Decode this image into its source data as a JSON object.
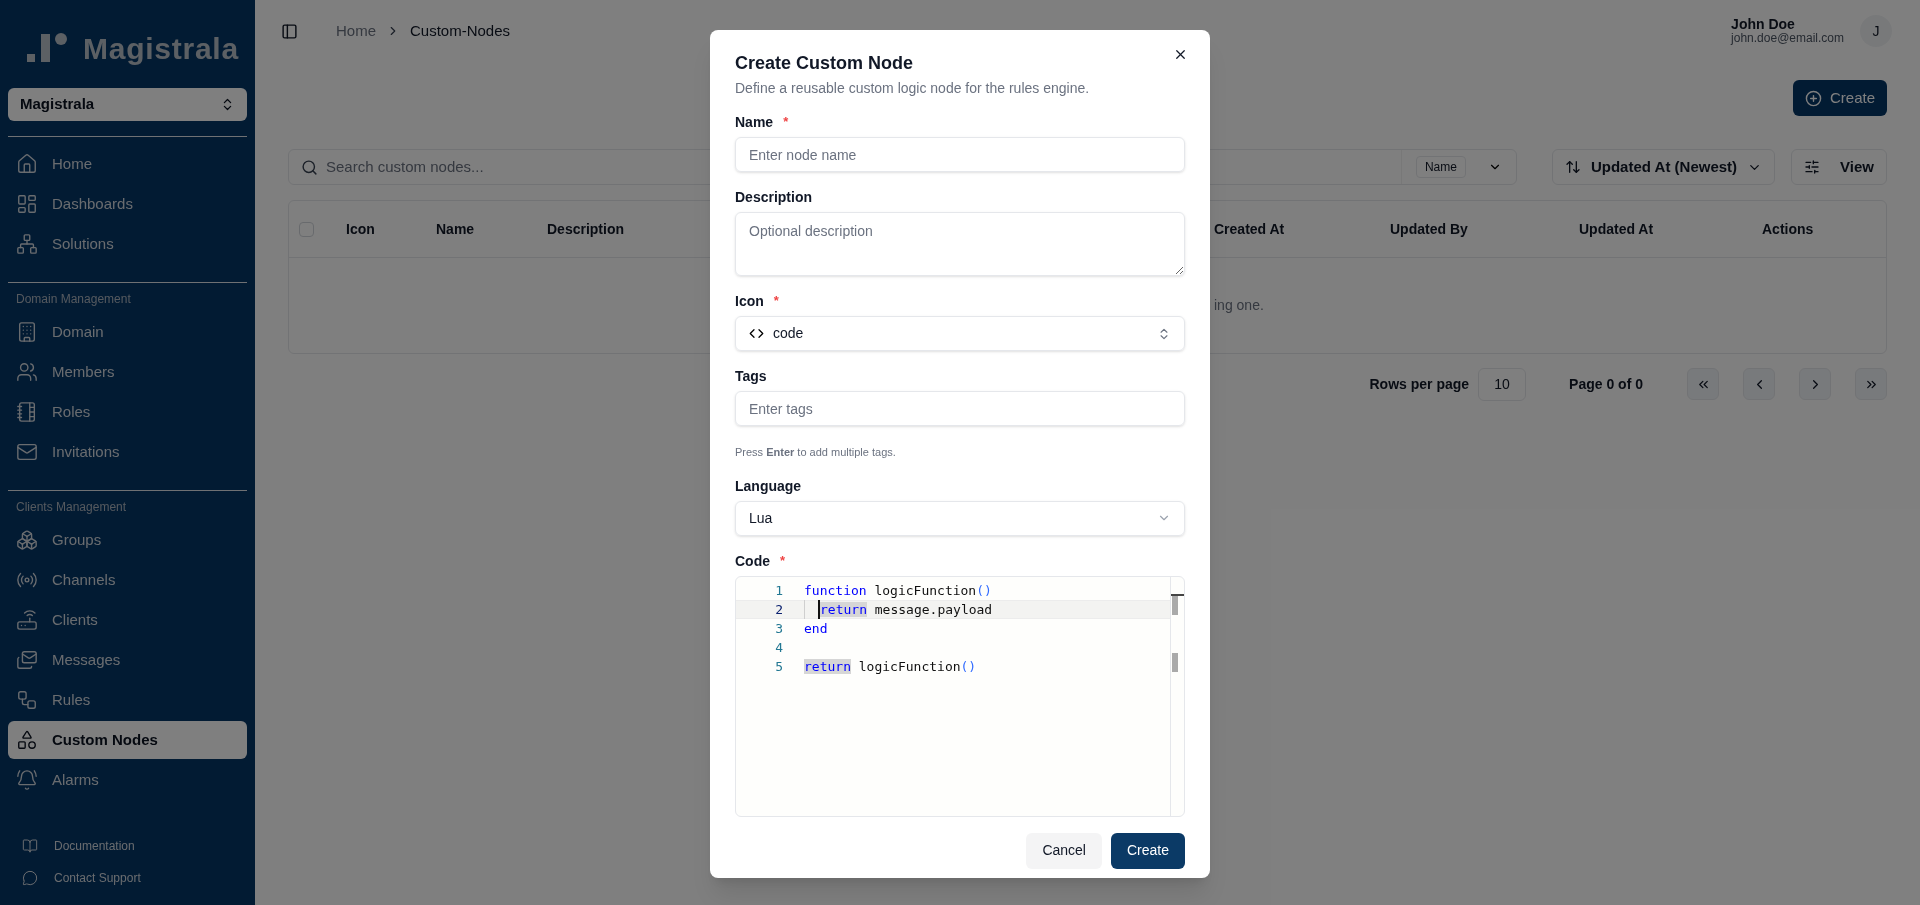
{
  "sidebar": {
    "logo": "Magistrala",
    "workspace": "Magistrala",
    "sections": [
      {
        "items": [
          {
            "label": "Home",
            "selected": false
          },
          {
            "label": "Dashboards",
            "selected": false
          },
          {
            "label": "Solutions",
            "selected": false
          }
        ]
      },
      {
        "heading": "Domain Management",
        "items": [
          {
            "label": "Domain",
            "selected": false
          },
          {
            "label": "Members",
            "selected": false
          },
          {
            "label": "Roles",
            "selected": false
          },
          {
            "label": "Invitations",
            "selected": false
          }
        ]
      },
      {
        "heading": "Clients Management",
        "items": [
          {
            "label": "Groups",
            "selected": false
          },
          {
            "label": "Channels",
            "selected": false
          },
          {
            "label": "Clients",
            "selected": false
          },
          {
            "label": "Messages",
            "selected": false
          },
          {
            "label": "Rules",
            "selected": false
          },
          {
            "label": "Custom Nodes",
            "selected": true
          },
          {
            "label": "Alarms",
            "selected": false
          }
        ]
      }
    ],
    "footer_links": [
      "Documentation",
      "Contact Support"
    ]
  },
  "header": {
    "breadcrumbs": [
      {
        "label": "Home",
        "current": false
      },
      {
        "label": "Custom-Nodes",
        "current": true
      }
    ],
    "user": {
      "name": "John Doe",
      "email": "john.doe@email.com",
      "initial": "J"
    }
  },
  "toolbar": {
    "create_button": "Create",
    "search": {
      "placeholder": "Search custom nodes...",
      "filter": "Name"
    },
    "sort": "Updated At (Newest)",
    "view": "View"
  },
  "table": {
    "select_all": {
      "checked": false
    },
    "columns": [
      "Icon",
      "Name",
      "Description",
      "Created At",
      "Updated By",
      "Updated At",
      "Actions"
    ],
    "empty_message": "ing one."
  },
  "pagination": {
    "rows_label": "Rows per page",
    "rows_value": "10",
    "page": "Page 0 of 0"
  },
  "dialog": {
    "title": "Create Custom Node",
    "subtitle": "Define a reusable custom logic node for the rules engine.",
    "fields": [
      {
        "kind": "input",
        "label": "Name",
        "required_mark": "*",
        "placeholder": "Enter node name"
      },
      {
        "kind": "textarea",
        "label": "Description",
        "placeholder": "Optional description"
      },
      {
        "kind": "icon-select",
        "label": "Icon",
        "required_mark": "*",
        "value": "code"
      },
      {
        "kind": "input",
        "label": "Tags",
        "placeholder": "Enter tags",
        "hint": "Press **Enter** to add multiple tags."
      },
      {
        "kind": "select",
        "label": "Language",
        "value": "Lua"
      },
      {
        "kind": "code",
        "label": "Code",
        "required_mark": "*",
        "lines": [
          {
            "number": "1",
            "active": false,
            "indent": false,
            "tokens": [
              {
                "kind": "keyword",
                "text": "function",
                "highlighted": false
              },
              {
                "kind": "plain",
                "text": " logicFunction",
                "highlighted": false
              },
              {
                "kind": "paren",
                "text": "()",
                "highlighted": false
              }
            ]
          },
          {
            "number": "2",
            "active": true,
            "indent": true,
            "tokens": [
              {
                "kind": "keyword",
                "text": "return",
                "highlighted": true
              },
              {
                "kind": "plain",
                "text": " message.payload",
                "highlighted": false
              }
            ]
          },
          {
            "number": "3",
            "active": false,
            "indent": false,
            "tokens": [
              {
                "kind": "keyword",
                "text": "end",
                "highlighted": false
              }
            ]
          },
          {
            "number": "4",
            "active": false,
            "indent": false
          },
          {
            "number": "5",
            "active": false,
            "indent": false,
            "tokens": [
              {
                "kind": "keyword",
                "text": "return",
                "highlighted": true
              },
              {
                "kind": "plain",
                "text": " logicFunction",
                "highlighted": false
              },
              {
                "kind": "paren",
                "text": "()",
                "highlighted": false
              }
            ]
          }
        ]
      }
    ],
    "buttons": [
      {
        "kind": "secondary",
        "label": "Cancel"
      },
      {
        "kind": "primary",
        "label": "Create"
      }
    ]
  }
}
